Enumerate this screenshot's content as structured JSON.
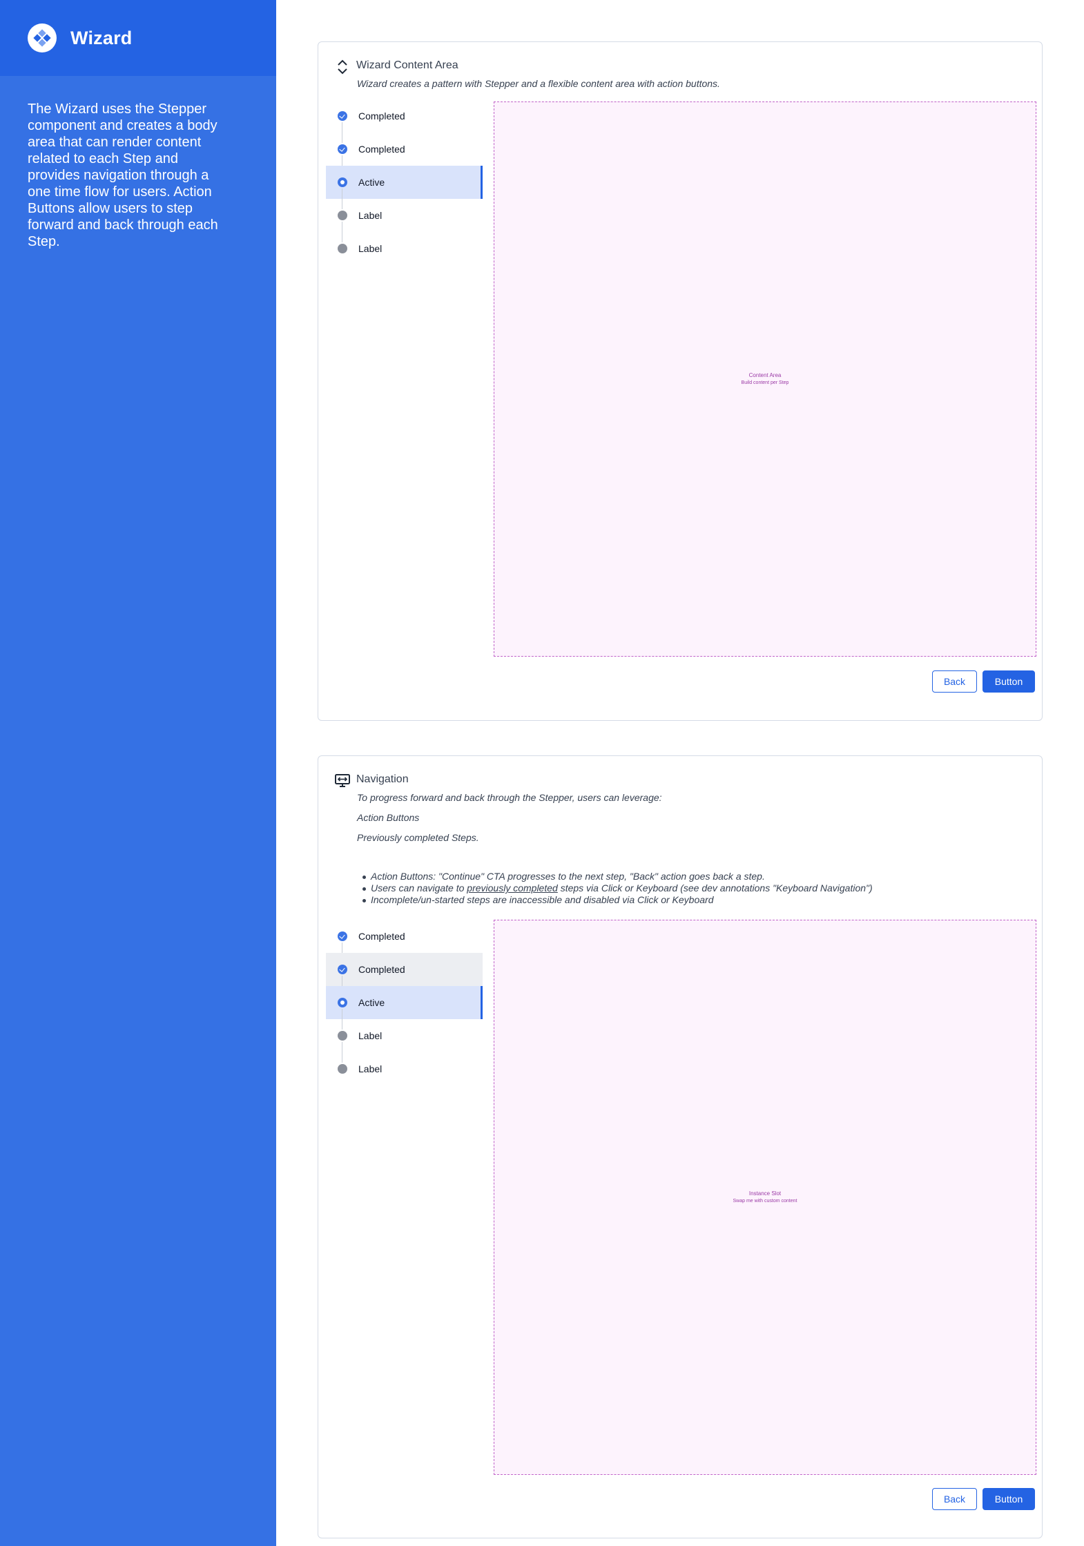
{
  "sidebar": {
    "title": "Wizard",
    "description": "The Wizard uses the Stepper component and creates a body area that can render content related to each Step and provides navigation through a one time flow for users. Action Buttons allow users to step forward and back through each Step.",
    "color": "#3571e4",
    "header_color": "#2463e3"
  },
  "content_section": {
    "title": "Wizard Content Area",
    "icon": "expand-collapse-icon",
    "subtitle": "Wizard creates a pattern with Stepper and a flexible content area with action buttons.",
    "steps": [
      {
        "label": "Completed",
        "state": "completed"
      },
      {
        "label": "Completed",
        "state": "completed"
      },
      {
        "label": "Active",
        "state": "active"
      },
      {
        "label": "Label",
        "state": "pending"
      },
      {
        "label": "Label",
        "state": "pending"
      }
    ],
    "slot_title": "Content Area",
    "slot_subtitle": "Build content per Step",
    "back_label": "Back",
    "primary_label": "Button"
  },
  "navigation_section": {
    "title": "Navigation",
    "icon": "monitor-arrows-icon",
    "intro": "To progress forward and back through the Stepper, users can leverage:",
    "item_action_buttons": "Action Buttons",
    "item_previous_steps": "Previously completed Steps.",
    "bullets": [
      "Action Buttons: \"Continue\" CTA progresses to the next step, \"Back\" action goes back a step.",
      "Users can navigate to previously completed steps via Click or Keyboard (see dev annotations \"Keyboard Navigation\")",
      "Incomplete/un-started steps are inaccessible and disabled via Click or Keyboard"
    ],
    "bullet2_pre": "Users can navigate to ",
    "bullet2_link": "previously completed",
    "bullet2_post": " steps via Click or Keyboard (see dev annotations \"Keyboard Navigation\")",
    "steps": [
      {
        "label": "Completed",
        "state": "completed"
      },
      {
        "label": "Completed",
        "state": "completed"
      },
      {
        "label": "Active",
        "state": "active"
      },
      {
        "label": "Label",
        "state": "pending"
      },
      {
        "label": "Label",
        "state": "pending"
      }
    ],
    "slot_title": "Instance Slot",
    "slot_subtitle": "Swap me with custom content",
    "back_label": "Back",
    "primary_label": "Button"
  }
}
